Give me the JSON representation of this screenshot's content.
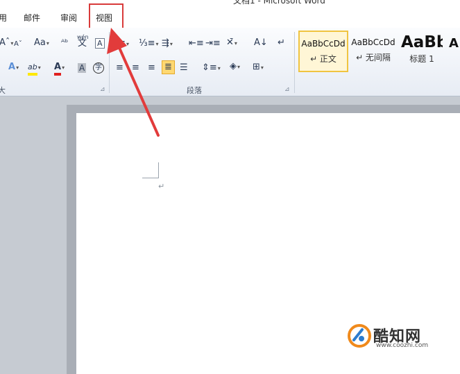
{
  "window": {
    "title": "文档1 - Microsoft Word"
  },
  "tabs": [
    {
      "label": "用"
    },
    {
      "label": "邮件"
    },
    {
      "label": "审阅"
    },
    {
      "label": "视图"
    }
  ],
  "ribbon": {
    "font_group_label": "大",
    "paragraph_group_label": "段落",
    "font_case_label": "Aa",
    "text_box_glyph": "A",
    "char_shading_glyph": "A",
    "char_border_glyph": "字",
    "phonetic_top": "wén",
    "phonetic_glyph": "文",
    "highlight_glyph": "ab",
    "font_color_glyph": "A",
    "text_effect_glyph": "A"
  },
  "styles": [
    {
      "sample": "AaBbCcDd",
      "name": "↵ 正文"
    },
    {
      "sample": "AaBbCcDd",
      "name": "↵ 无间隔"
    },
    {
      "sample": "AaBb",
      "name": "标题 1"
    },
    {
      "sample": "A",
      "name": ""
    }
  ],
  "document": {
    "paragraph_mark": "↵"
  },
  "watermark": {
    "name": "酷知网",
    "url": "www.coozhi.com"
  },
  "colors": {
    "highlight_box": "#d83a3a",
    "arrow": "#e23b3b",
    "selected_style": "#f0c440"
  }
}
